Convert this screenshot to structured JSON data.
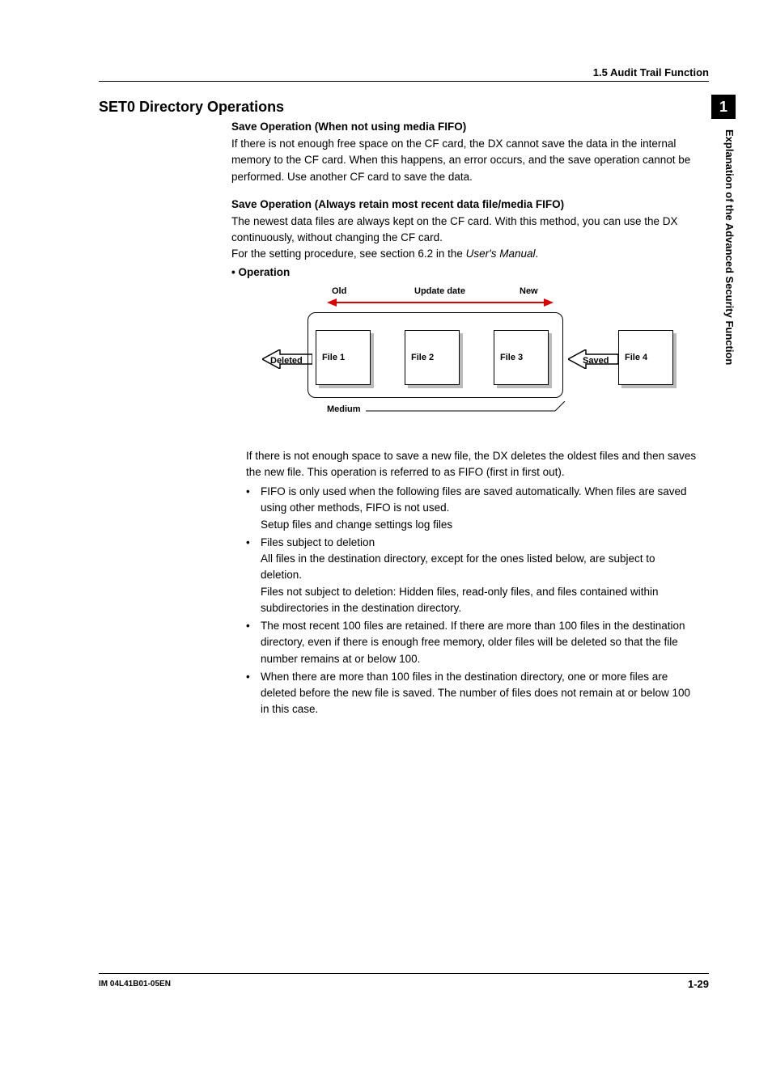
{
  "header": {
    "section": "1.5  Audit Trail Function"
  },
  "sidetab": {
    "number": "1",
    "label": "Explanation of the Advanced Security Function"
  },
  "main": {
    "title": "SET0 Directory Operations",
    "sub1": {
      "heading": "Save Operation (When not using media FIFO)",
      "para": "If there is not enough free space on the CF card, the DX cannot save the data in the internal memory to the CF card. When this happens, an error occurs, and the save operation cannot be performed. Use another CF card to save the data."
    },
    "sub2": {
      "heading": "Save Operation (Always retain most recent data file/media FIFO)",
      "para1": "The newest data files are always kept on the CF card. With this method, you can use the DX continuously, without changing the CF card.",
      "para2a": "For the setting procedure, see section 6.2 in the ",
      "para2b": "User's Manual",
      "para2c": ".",
      "op_label": "Operation",
      "diagram": {
        "old": "Old",
        "update": "Update date",
        "new_lbl": "New",
        "deleted": "Deleted",
        "file1": "File 1",
        "file2": "File 2",
        "file3": "File 3",
        "file4": "File 4",
        "saved": "Saved",
        "medium": "Medium"
      },
      "after_para": "If there is not enough space to save a new file, the DX deletes the oldest files and then saves the new file. This operation is referred to as FIFO (first in first out).",
      "bullets": [
        {
          "lines": [
            "FIFO is only used when the following files are saved automatically. When files are saved using other methods, FIFO is not used.",
            "Setup files and change settings log files"
          ]
        },
        {
          "lines": [
            "Files subject to deletion",
            "All files in the destination directory, except for the ones listed below, are subject to deletion.",
            "Files not subject to deletion: Hidden files, read-only files, and files contained within subdirectories in the destination directory."
          ]
        },
        {
          "lines": [
            "The most recent 100 files are retained. If there are more than 100 files in the destination directory, even if there is enough free memory, older files will be deleted so that the file number remains at or below 100."
          ]
        },
        {
          "lines": [
            "When there are more than 100 files in the destination directory, one or more files are deleted before the new file is saved. The number of files does not remain at or below 100 in this case."
          ]
        }
      ]
    }
  },
  "footer": {
    "left": "IM 04L41B01-05EN",
    "right": "1-29"
  }
}
